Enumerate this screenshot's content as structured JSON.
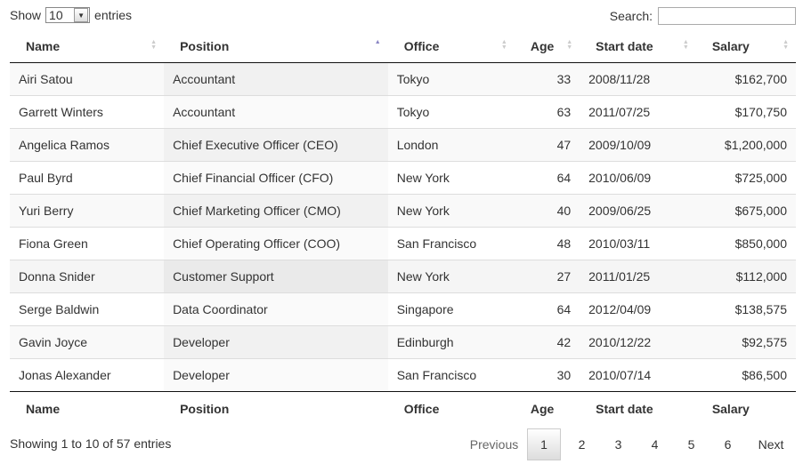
{
  "length": {
    "show": "Show",
    "value": "10",
    "entries": "entries"
  },
  "search": {
    "label": "Search:",
    "value": ""
  },
  "columns": [
    "Name",
    "Position",
    "Office",
    "Age",
    "Start date",
    "Salary"
  ],
  "sorted_column": "Position",
  "sort_direction": "ascending",
  "rows": [
    [
      "Airi Satou",
      "Accountant",
      "Tokyo",
      "33",
      "2008/11/28",
      "$162,700"
    ],
    [
      "Garrett Winters",
      "Accountant",
      "Tokyo",
      "63",
      "2011/07/25",
      "$170,750"
    ],
    [
      "Angelica Ramos",
      "Chief Executive Officer (CEO)",
      "London",
      "47",
      "2009/10/09",
      "$1,200,000"
    ],
    [
      "Paul Byrd",
      "Chief Financial Officer (CFO)",
      "New York",
      "64",
      "2010/06/09",
      "$725,000"
    ],
    [
      "Yuri Berry",
      "Chief Marketing Officer (CMO)",
      "New York",
      "40",
      "2009/06/25",
      "$675,000"
    ],
    [
      "Fiona Green",
      "Chief Operating Officer (COO)",
      "San Francisco",
      "48",
      "2010/03/11",
      "$850,000"
    ],
    [
      "Donna Snider",
      "Customer Support",
      "New York",
      "27",
      "2011/01/25",
      "$112,000"
    ],
    [
      "Serge Baldwin",
      "Data Coordinator",
      "Singapore",
      "64",
      "2012/04/09",
      "$138,575"
    ],
    [
      "Gavin Joyce",
      "Developer",
      "Edinburgh",
      "42",
      "2010/12/22",
      "$92,575"
    ],
    [
      "Jonas Alexander",
      "Developer",
      "San Francisco",
      "30",
      "2010/07/14",
      "$86,500"
    ]
  ],
  "info": "Showing 1 to 10 of 57 entries",
  "pagination": {
    "previous": "Previous",
    "pages": [
      "1",
      "2",
      "3",
      "4",
      "5",
      "6"
    ],
    "current": "1",
    "next": "Next"
  }
}
